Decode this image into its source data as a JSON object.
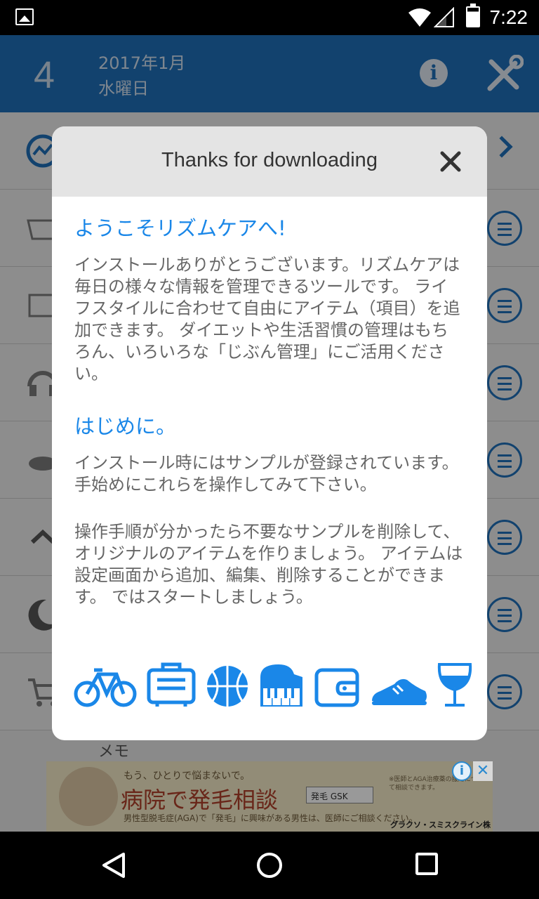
{
  "status_bar": {
    "time": "7:22"
  },
  "header": {
    "day": "4",
    "year_month": "2017年1月",
    "weekday": "水曜日"
  },
  "background": {
    "memo_label": "メモ"
  },
  "ad": {
    "tagline": "もう、ひとりで悩まないで。",
    "headline": "病院で発毛相談",
    "search_box": "発毛 GSK",
    "subtext": "男性型脱毛症(AGA)で「発毛」に興味がある男性は、医師にご相談ください。",
    "fineprint": "※医師とAGA治療薬の服用について相談できます。",
    "sponsor": "グラクソ・スミスクライン株式会社"
  },
  "dialog": {
    "title": "Thanks for downloading",
    "heading1": "ようこそリズムケアへ!",
    "para1": "インストールありがとうございます。リズムケアは毎日の様々な情報を管理できるツールです。 ライフスタイルに合わせて自由にアイテム（項目）を追加できます。 ダイエットや生活習慣の管理はもちろん、いろいろな「じぶん管理」にご活用ください。",
    "heading2": "はじめに。",
    "para2": "インストール時にはサンプルが登録されています。手始めにこれらを操作してみて下さい。",
    "para3": " 操作手順が分かったら不要なサンプルを削除して、オリジナルのアイテムを作りましょう。 アイテムは設定画面から追加、編集、削除することができます。 ではスタートしましょう。",
    "icons": [
      "bicycle-icon",
      "suitcase-icon",
      "basketball-icon",
      "piano-icon",
      "wallet-icon",
      "sneaker-icon",
      "wine-glass-icon"
    ]
  },
  "colors": {
    "accent": "#1a87e8",
    "header": "#1f6fb8"
  }
}
